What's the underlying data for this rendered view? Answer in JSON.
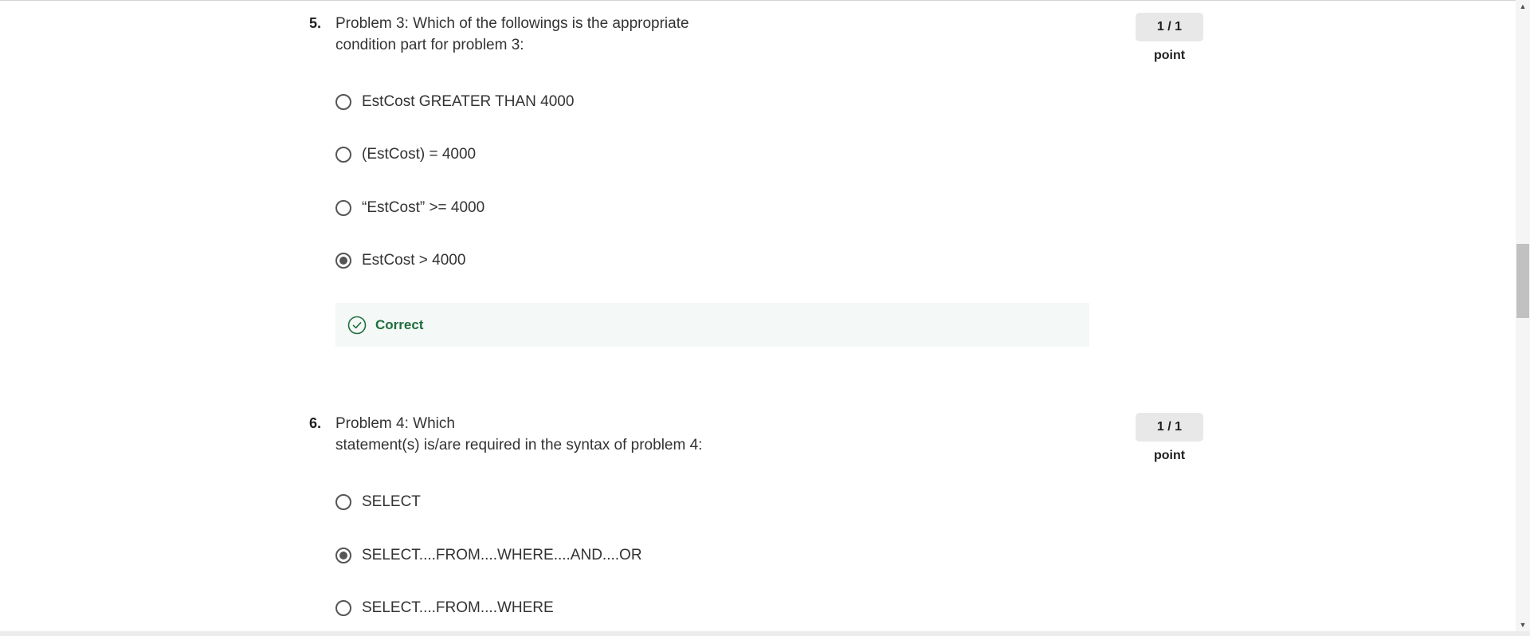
{
  "questions": [
    {
      "number": "5.",
      "text_lines": [
        "Problem 3: Which of the followings is the appropriate",
        "condition part for problem 3:"
      ],
      "points": "1 / 1 point",
      "options": [
        {
          "label": "EstCost GREATER THAN 4000",
          "selected": false
        },
        {
          "label": "(EstCost) = 4000",
          "selected": false
        },
        {
          "label": "“EstCost” >= 4000",
          "selected": false
        },
        {
          "label": "EstCost > 4000",
          "selected": true
        }
      ],
      "feedback": {
        "label": "Correct",
        "icon": "check-circle-icon",
        "color": "#1f6e3d"
      }
    },
    {
      "number": "6.",
      "text_lines": [
        "Problem 4: Which",
        "statement(s) is/are required in the syntax of problem 4:"
      ],
      "points": "1 / 1 point",
      "options": [
        {
          "label": "SELECT",
          "selected": false
        },
        {
          "label": "SELECT....FROM....WHERE....AND....OR",
          "selected": true
        },
        {
          "label": "SELECT....FROM....WHERE",
          "selected": false
        }
      ]
    }
  ],
  "scrollbar": {
    "up_icon": "triangle-up-icon",
    "down_icon": "triangle-down-icon"
  }
}
